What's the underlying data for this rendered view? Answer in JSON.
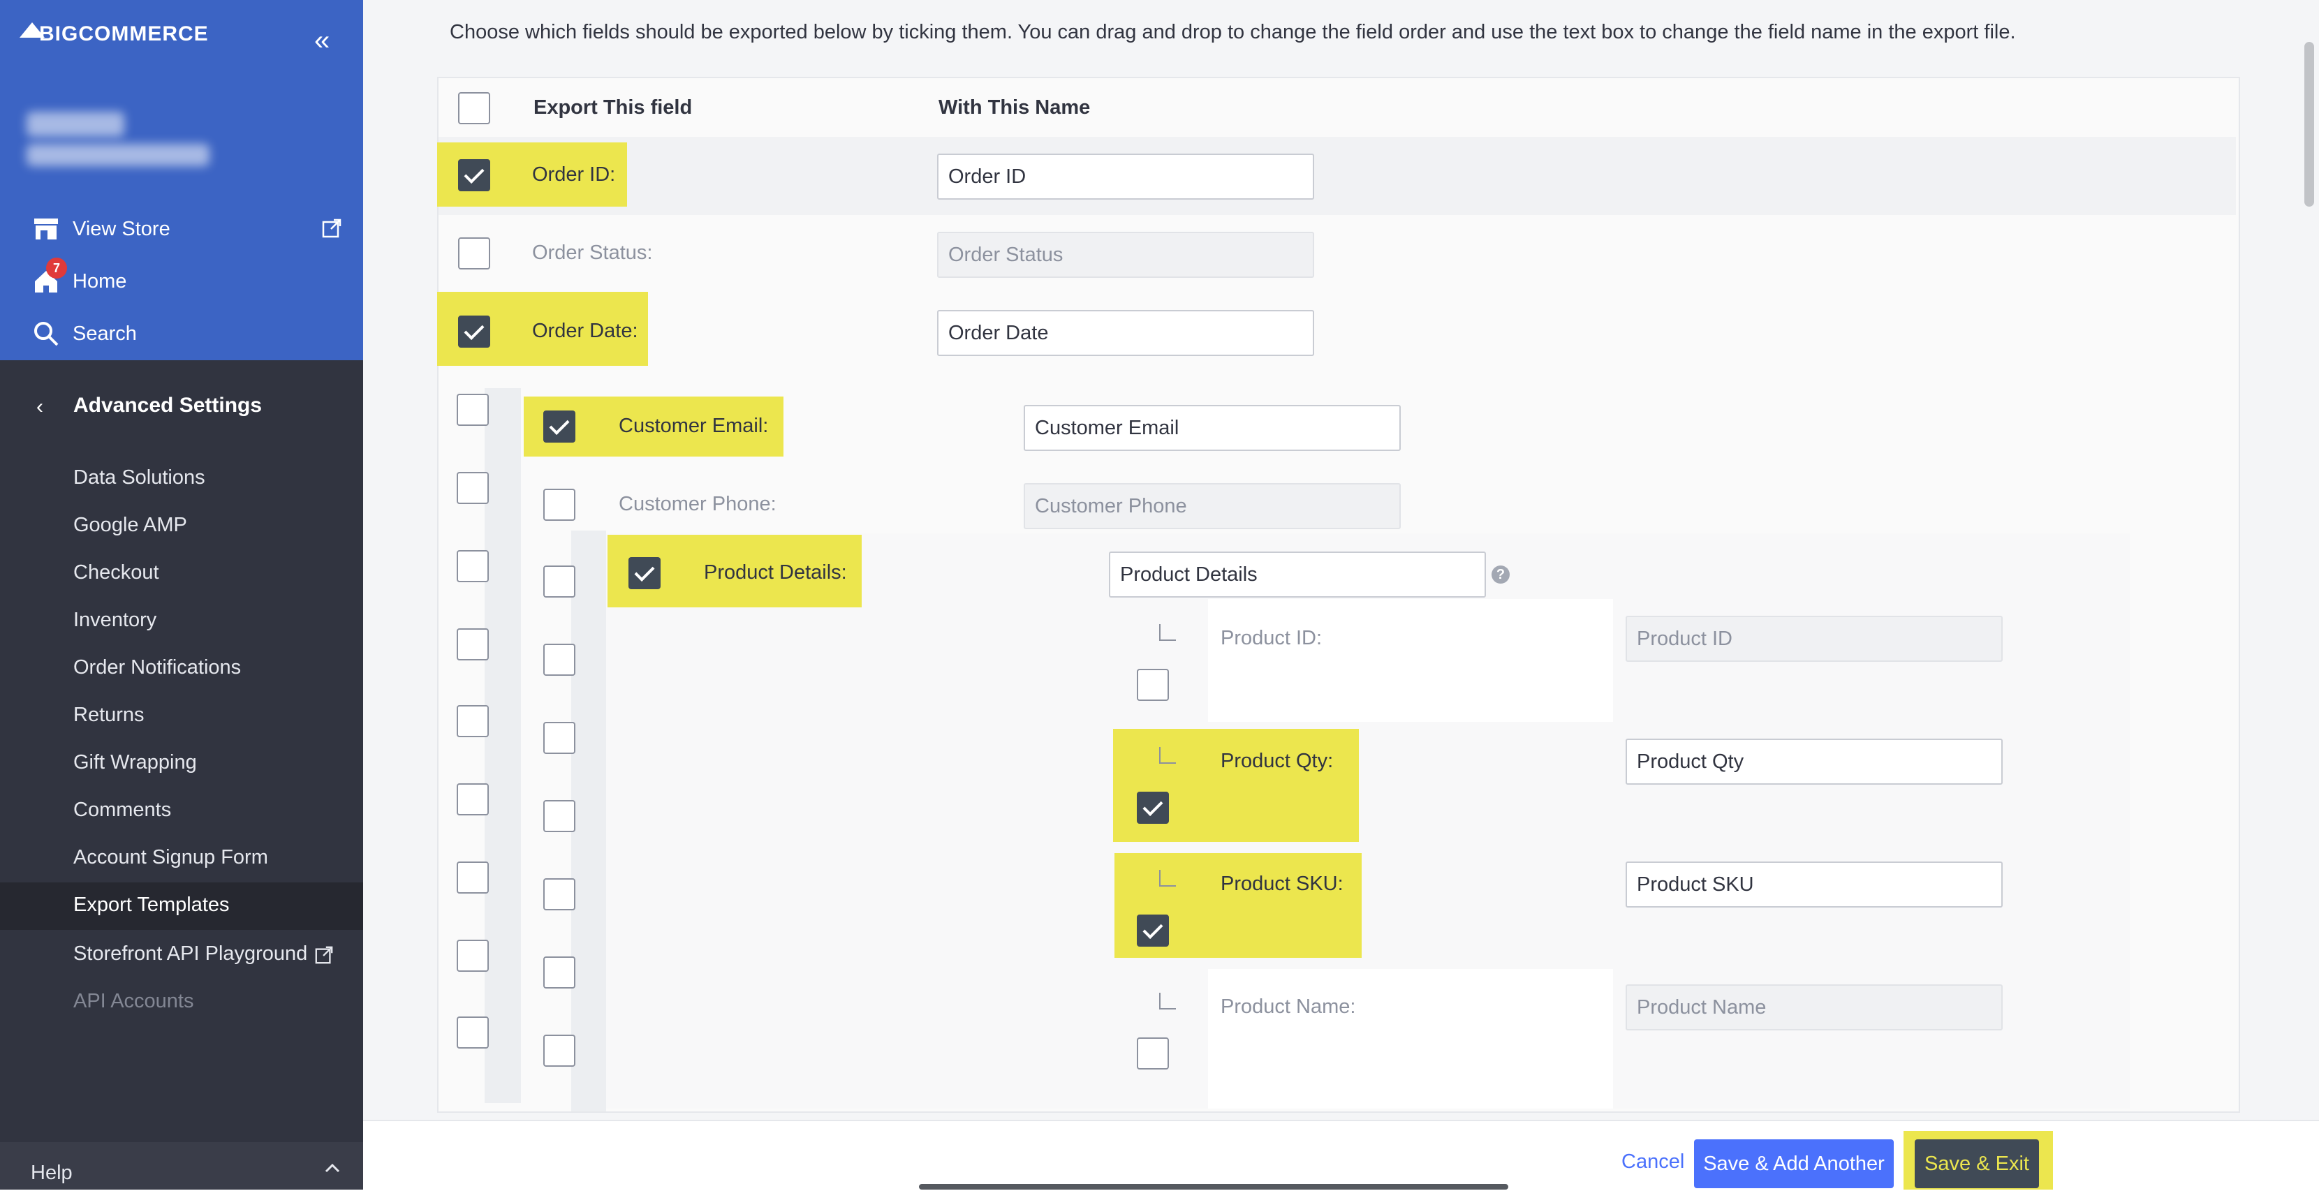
{
  "brand": {
    "logo_text": "BIGCOMMERCE"
  },
  "sidebar": {
    "collapse_icon": "double-chevron-left-icon",
    "top_nav": [
      {
        "label": "View Store",
        "icon": "storefront-icon",
        "external_icon": "external-link-icon"
      },
      {
        "label": "Home",
        "icon": "home-icon",
        "badge": "7"
      },
      {
        "label": "Search",
        "icon": "search-icon"
      }
    ],
    "section": {
      "label": "Advanced Settings",
      "icon": "chevron-left-icon"
    },
    "items": [
      {
        "label": "Data Solutions"
      },
      {
        "label": "Google AMP"
      },
      {
        "label": "Checkout"
      },
      {
        "label": "Inventory"
      },
      {
        "label": "Order Notifications"
      },
      {
        "label": "Returns"
      },
      {
        "label": "Gift Wrapping"
      },
      {
        "label": "Comments"
      },
      {
        "label": "Account Signup Form"
      },
      {
        "label": "Export Templates",
        "active": true
      },
      {
        "label": "Storefront API Playground",
        "external_icon": "external-link-icon"
      },
      {
        "label": "API Accounts",
        "disabled": true
      }
    ],
    "help": {
      "label": "Help",
      "icon": "chevron-up-icon"
    }
  },
  "main": {
    "intro": "Choose which fields should be exported below by ticking them. You can drag and drop to change the field order and use the text box to change the field name in the export file.",
    "headers": {
      "export": "Export This field",
      "name": "With This Name"
    },
    "fields": [
      {
        "label": "Order ID:",
        "value": "Order ID",
        "checked": true
      },
      {
        "label": "Order Status:",
        "value": "Order Status",
        "checked": false
      },
      {
        "label": "Order Date:",
        "value": "Order Date",
        "checked": true
      },
      {
        "label": "Customer Email:",
        "value": "Customer Email",
        "checked": true
      },
      {
        "label": "Customer Phone:",
        "value": "Customer Phone",
        "checked": false
      },
      {
        "label": "Product Details:",
        "value": "Product Details",
        "checked": true
      }
    ],
    "sub_fields": [
      {
        "label": "Product ID:",
        "value": "Product ID",
        "checked": false
      },
      {
        "label": "Product Qty:",
        "value": "Product Qty",
        "checked": true
      },
      {
        "label": "Product SKU:",
        "value": "Product SKU",
        "checked": true
      },
      {
        "label": "Product Name:",
        "value": "Product Name",
        "checked": false
      }
    ],
    "help_icon": "question-icon"
  },
  "footer": {
    "cancel": "Cancel",
    "save_add": "Save & Add Another",
    "save_exit": "Save & Exit"
  },
  "colors": {
    "sidebar_dark": "#313440",
    "sidebar_blue": "#3c64c4",
    "highlight": "#ece64e",
    "primary": "#4b71fc",
    "check": "#404a56"
  }
}
